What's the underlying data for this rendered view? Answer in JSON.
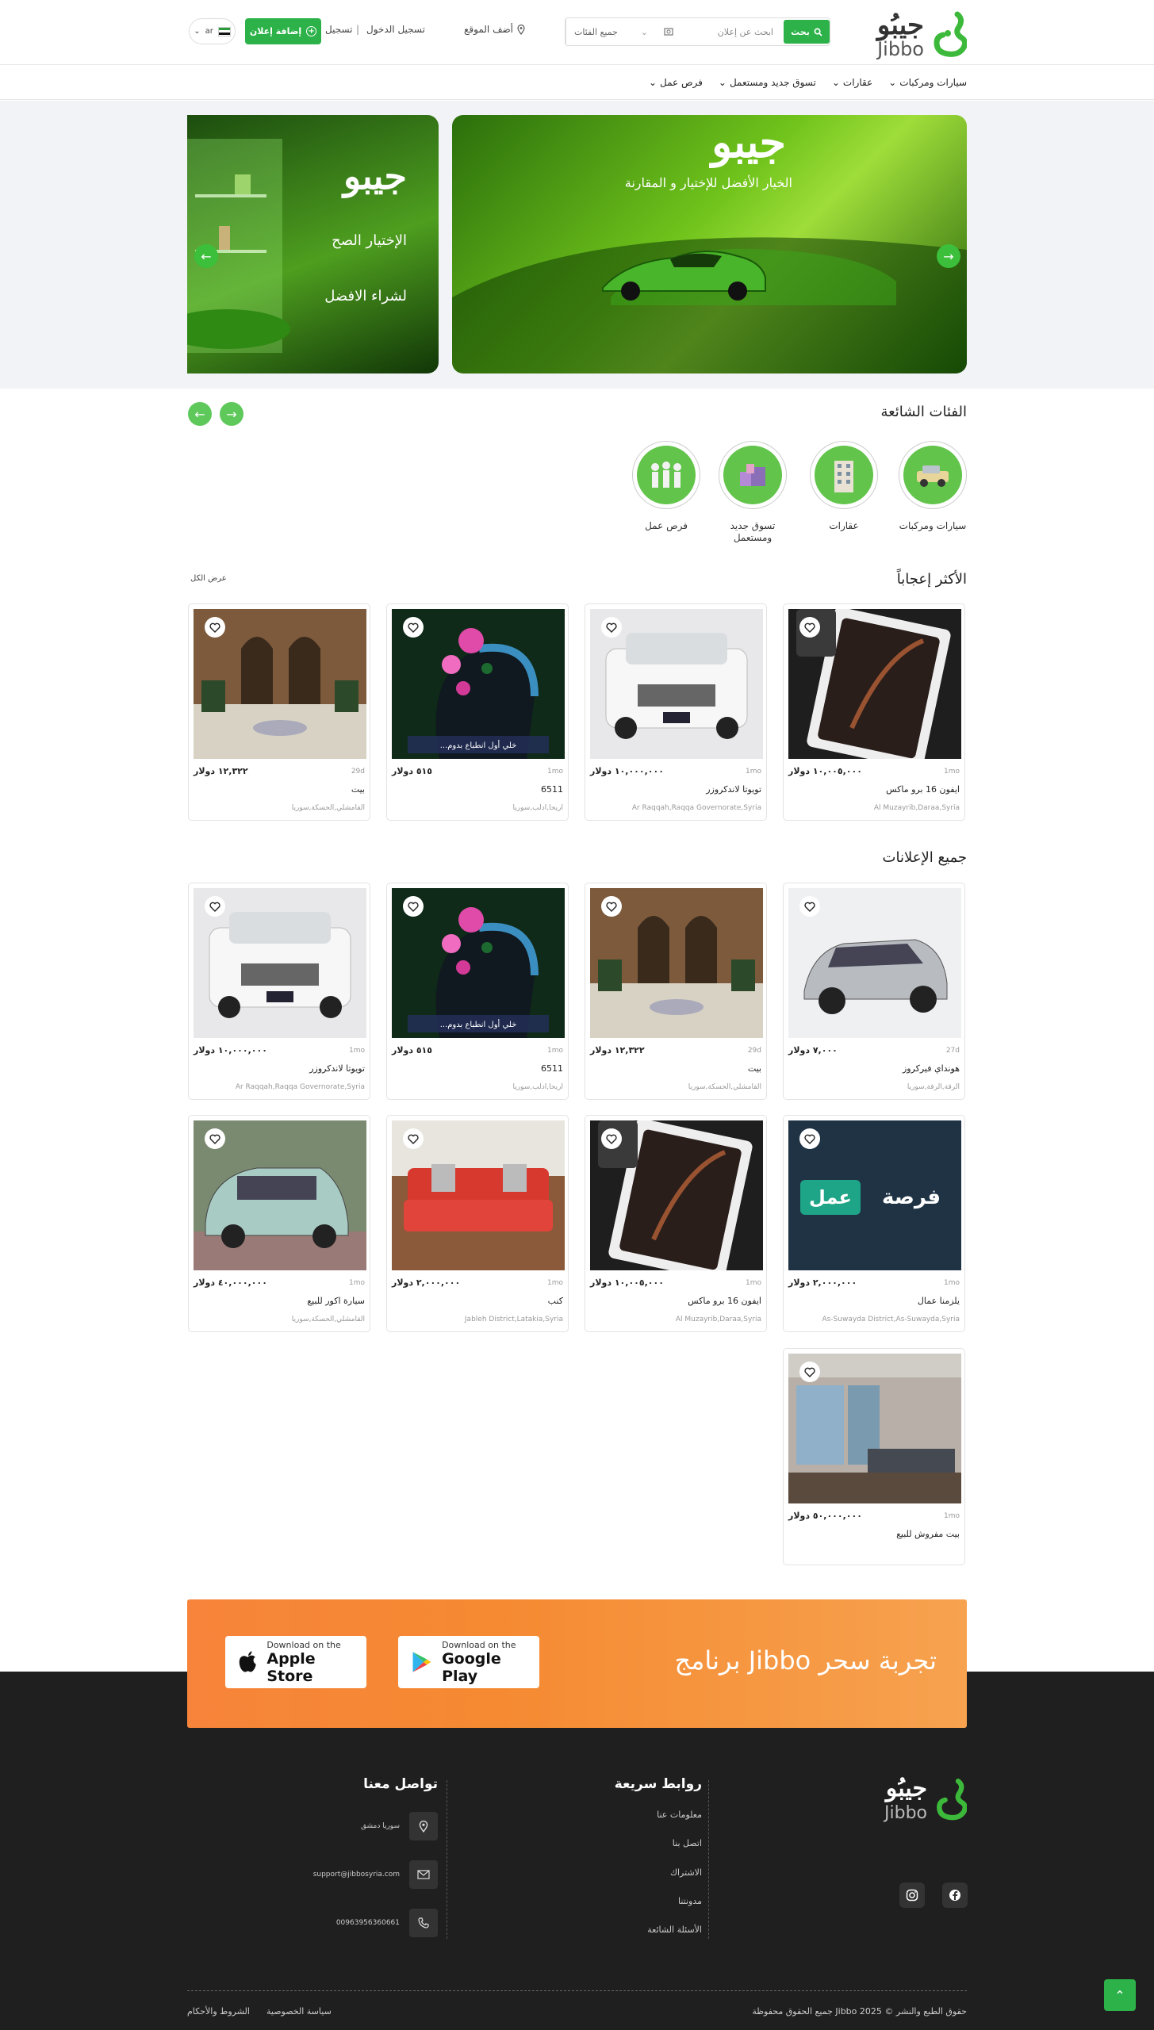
{
  "header": {
    "logo_ar": "جيبُو",
    "logo_en": "Jibbo",
    "category_select": "جميع الفئات",
    "search_placeholder": "ابحث عن إعلان",
    "search_button": "بحث",
    "describe_location": "أضف الموقع",
    "login": "تسجيل الدخول",
    "separator": "|",
    "register": "تسجيل",
    "add_ad": "إضافة إعلان",
    "lang": "ar"
  },
  "nav": {
    "items": [
      "سيارات ومركبات",
      "عقارات",
      "تسوق جديد ومستعمل",
      "فرص عمل"
    ]
  },
  "hero": {
    "main_title": "جيبو",
    "main_subtitle": "الخيار الأفضل للإختيار و المقارنة",
    "side_title": "جيبو",
    "side_line1": "الإختيار الصح",
    "side_line2": "لشراء الافضل"
  },
  "popular": {
    "title": "الفئات الشائعة",
    "categories": [
      {
        "label": "سيارات ومركبات",
        "icon": "car-icon"
      },
      {
        "label": "عقارات",
        "icon": "building-icon"
      },
      {
        "label": "تسوق جديد ومستعمل",
        "icon": "shopping-icon"
      },
      {
        "label": "فرص عمل",
        "icon": "workers-icon"
      }
    ]
  },
  "liked": {
    "title": "الأكثر إعجاباً",
    "view_all": "عرض الكل",
    "cards": [
      {
        "price": "١٠,٠٠٥,٠٠٠ دولار",
        "time": "1mo",
        "title": "ايفون 16 برو ماكس",
        "location": "Al Muzayrib,Daraa,Syria",
        "image": "phone"
      },
      {
        "price": "١٠,٠٠٠,٠٠٠ دولار",
        "time": "1mo",
        "title": "تويوتا لاندكروزر",
        "location": "Ar Raqqah,Raqqa Governorate,Syria",
        "image": "suv"
      },
      {
        "price": "٥١٥ دولار",
        "time": "1mo",
        "title": "6511",
        "location": "اريحا,ادلب,سوريا",
        "image": "art"
      },
      {
        "price": "١٢,٣٢٢ دولار",
        "time": "29d",
        "title": "بيت",
        "location": "القامشلي,الحسكة,سوريا",
        "image": "house"
      }
    ]
  },
  "all_ads": {
    "title": "جميع الإعلانات",
    "cards": [
      {
        "price": "٧,٠٠٠ دولار",
        "time": "27d",
        "title": "هونداي فيركروز",
        "location": "الرقة,الرقة,سوريا",
        "image": "silver-suv"
      },
      {
        "price": "١٢,٣٢٢ دولار",
        "time": "29d",
        "title": "بيت",
        "location": "القامشلي,الحسكة,سوريا",
        "image": "house"
      },
      {
        "price": "٥١٥ دولار",
        "time": "1mo",
        "title": "6511",
        "location": "اريحا,ادلب,سوريا",
        "image": "art"
      },
      {
        "price": "١٠,٠٠٠,٠٠٠ دولار",
        "time": "1mo",
        "title": "تويوتا لاندكروزر",
        "location": "Ar Raqqah,Raqqa Governorate,Syria",
        "image": "suv"
      },
      {
        "price": "٢,٠٠٠,٠٠٠ دولار",
        "time": "1mo",
        "title": "يلزمنا عمال",
        "location": "As-Suwayda District,As-Suwayda,Syria",
        "image": "job"
      },
      {
        "price": "١٠,٠٠٥,٠٠٠ دولار",
        "time": "1mo",
        "title": "ايفون 16 برو ماكس",
        "location": "Al Muzayrib,Daraa,Syria",
        "image": "phone"
      },
      {
        "price": "٢,٠٠٠,٠٠٠ دولار",
        "time": "1mo",
        "title": "كنب",
        "location": "Jableh District,Latakia,Syria",
        "image": "sofa"
      },
      {
        "price": "٤٠,٠٠٠,٠٠٠ دولار",
        "time": "1mo",
        "title": "سيارة اكور للبيع",
        "location": "القامشلي,الحسكة,سوريا",
        "image": "minivan"
      },
      {
        "price": "٥٠,٠٠٠,٠٠٠ دولار",
        "time": "1mo",
        "title": "بيت مفروش للبيع",
        "location": "",
        "image": "living"
      }
    ],
    "job_image_text": "فرصة عمل",
    "art_image_text": "خلي أول انطباع بدوم..."
  },
  "app_banner": {
    "text": "تجربة سحر Jibbo برنامج",
    "google_small": "Download on the",
    "google_big": "Google Play",
    "apple_small": "Download on the",
    "apple_big": "Apple Store"
  },
  "footer": {
    "links_title": "روابط سريعة",
    "links": [
      "معلومات عنا",
      "اتصل بنا",
      "الاشتراك",
      "مدونتنا",
      "الأسئلة الشائعة"
    ],
    "contact_title": "تواصل معنا",
    "address": "سوريا دمشق",
    "email": "support@jibbosyria.com",
    "phone": "00963956360661",
    "copyright": "حقوق الطبع والنشر © 2025 Jibbo جميع الحقوق محفوظة",
    "privacy": "سياسة الخصوصية",
    "terms": "الشروط والأحكام"
  },
  "colors": {
    "accent": "#2db24a",
    "banner": "#f58a32",
    "footer_bg": "#1f1f1f"
  }
}
